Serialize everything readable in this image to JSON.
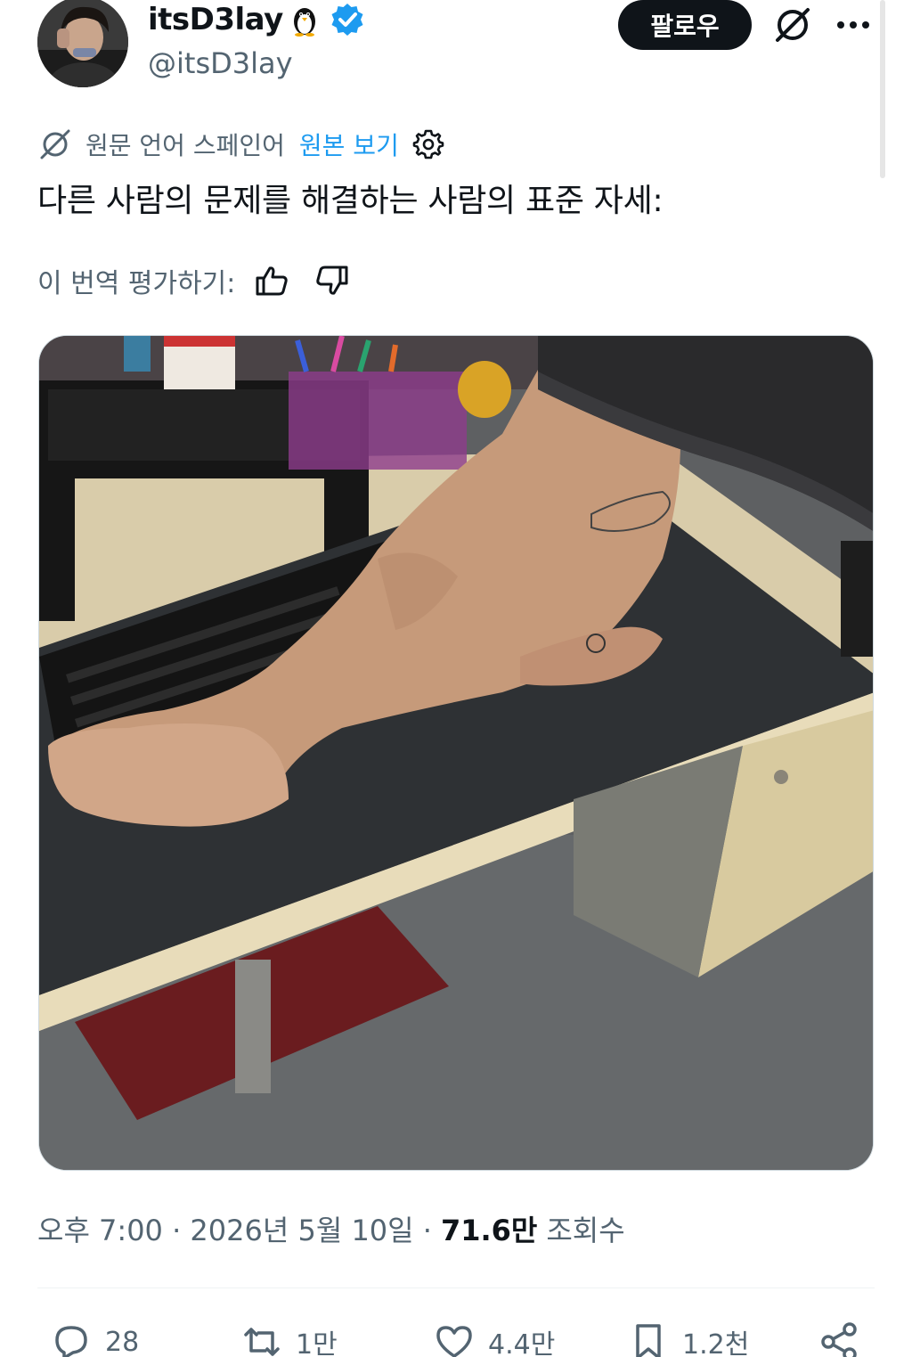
{
  "author": {
    "display_name": "itsD3lay",
    "handle": "@itsD3lay",
    "verified": true
  },
  "header": {
    "follow_label": "팔로우"
  },
  "translation": {
    "source_language": "원문 언어 스페인어",
    "show_original_label": "원본 보기",
    "rate_label": "이 번역 평가하기:"
  },
  "tweet": {
    "text": "다른 사람의 문제를 해결하는 사람의 표준 자세:"
  },
  "meta": {
    "timestamp": "오후 7:00 · 2026년 5월 10일 ·",
    "views_count": "71.6만",
    "views_label": "조회수"
  },
  "actions": {
    "replies": "28",
    "reposts": "1만",
    "likes": "4.4만",
    "bookmarks": "1.2천"
  },
  "colors": {
    "link_blue": "#1d9bf0",
    "verified_blue": "#1d9bf0",
    "secondary_text": "#536471",
    "primary_text": "#0f1419"
  }
}
